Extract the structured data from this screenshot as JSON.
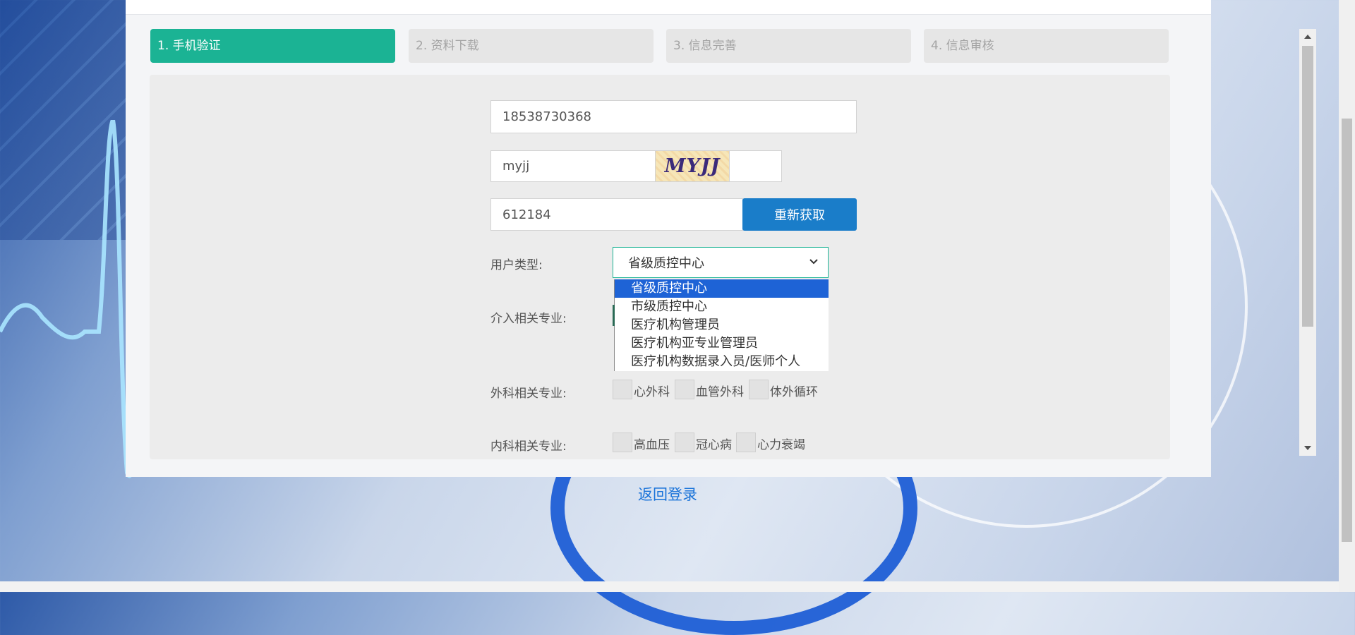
{
  "steps": [
    {
      "label": "1. 手机验证",
      "active": true
    },
    {
      "label": "2. 资料下载",
      "active": false
    },
    {
      "label": "3. 信息完善",
      "active": false
    },
    {
      "label": "4. 信息审核",
      "active": false
    }
  ],
  "form": {
    "phone_value": "18538730368",
    "captcha_value": "myjj",
    "captcha_image_text": "MYJJ",
    "sms_code_value": "612184",
    "refresh_button": "重新获取",
    "user_type_label": "用户类型:",
    "user_type_selected": "省级质控中心",
    "user_type_options": [
      "省级质控中心",
      "市级质控中心",
      "医疗机构管理员",
      "医疗机构亚专业管理员",
      "医疗机构数据录入员/医师个人"
    ],
    "interventional_label": "介入相关专业:",
    "surgery_label": "外科相关专业:",
    "surgery_options": [
      "心外科",
      "血管外科",
      "体外循环"
    ],
    "internal_label": "内科相关专业:",
    "internal_options": [
      "高血压",
      "冠心病",
      "心力衰竭"
    ]
  },
  "back_link": "返回登录",
  "colors": {
    "step_active": "#1bb394",
    "button_blue": "#1a7dc9",
    "dropdown_selected": "#1e63d6",
    "link": "#1a73d9"
  },
  "icons": {
    "select_chevron": "chevron-down-icon",
    "scroll_up": "scroll-up-arrow-icon",
    "scroll_down": "scroll-down-arrow-icon"
  }
}
